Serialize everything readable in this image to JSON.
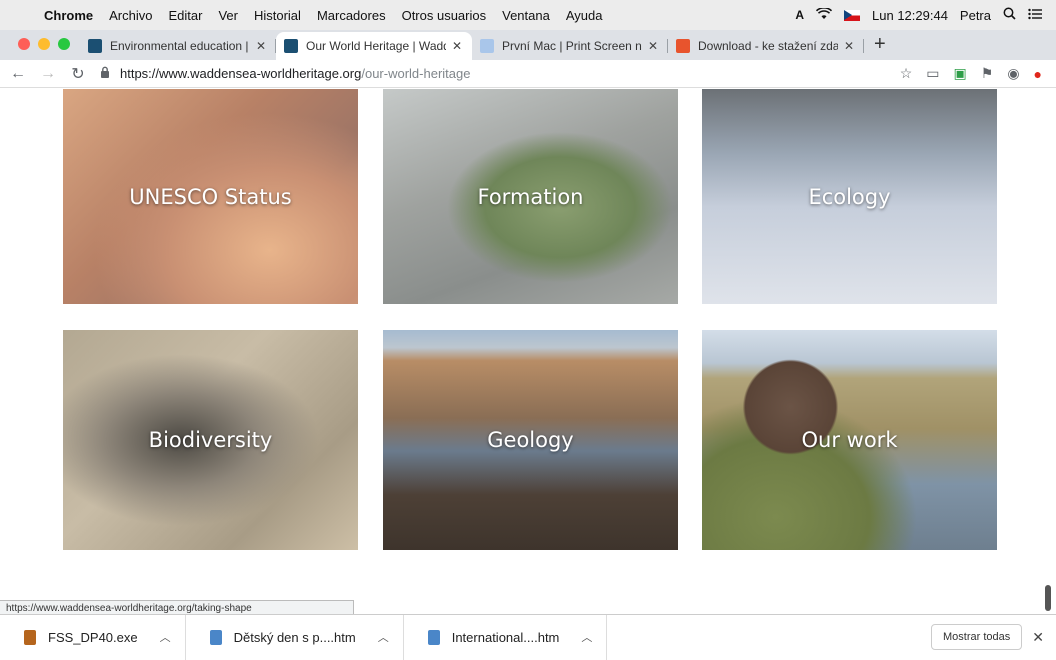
{
  "menubar": {
    "app": "Chrome",
    "items": [
      "Archivo",
      "Editar",
      "Ver",
      "Historial",
      "Marcadores",
      "Otros usuarios",
      "Ventana",
      "Ayuda"
    ],
    "clock": "Lun 12:29:44",
    "user": "Petra"
  },
  "tabs": [
    {
      "title": "Environmental education | Wad",
      "favicon_color": "#1b4f72"
    },
    {
      "title": "Our World Heritage | Wadden S",
      "favicon_color": "#1b4f72"
    },
    {
      "title": "První Mac | Print Screen na Ma",
      "favicon_color": "#a9c6ea"
    },
    {
      "title": "Download - ke stažení zdarma",
      "favicon_color": "#e8542d"
    }
  ],
  "address": {
    "host": "https://www.waddensea-worldheritage.org",
    "path": "/our-world-heritage"
  },
  "tiles": [
    {
      "label": "UNESCO Status"
    },
    {
      "label": "Formation"
    },
    {
      "label": "Ecology"
    },
    {
      "label": "Biodiversity"
    },
    {
      "label": "Geology"
    },
    {
      "label": "Our work"
    }
  ],
  "status_url": "https://www.waddensea-worldheritage.org/taking-shape",
  "downloads": [
    {
      "name": "FSS_DP40.exe",
      "icon_color": "#b5651d"
    },
    {
      "name": "Dětský den s p....htm",
      "icon_color": "#4a86c8"
    },
    {
      "name": "International....htm",
      "icon_color": "#4a86c8"
    }
  ],
  "show_all_label": "Mostrar todas"
}
